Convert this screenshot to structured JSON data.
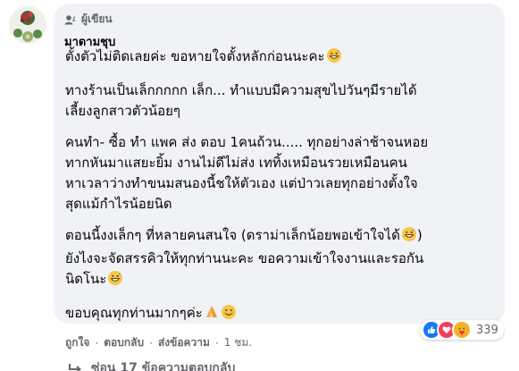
{
  "comment": {
    "author_badge": "ผู้เขียน",
    "author_name": "มาดามชุบ",
    "paragraphs": [
      {
        "lines": [
          "ตั้งตัวไม่ติดเลยค่ะ ขอหายใจตั้งหลักก่อนนะคะ"
        ]
      },
      {
        "lines": [
          "ทางร้านเป็นเล็กกกกก เล็ก... ทำแบบมีความสุขไปวันๆมีรายได้",
          "เลี้ยงลูกสาวตัวน้อยๆ"
        ]
      },
      {
        "lines": [
          "คนทำ- ซื้อ ทำ แพค ส่ง ตอบ 1คนถ้วน..... ทุกอย่างล่าช้าจนหอย",
          "ทากหันมาแสยะยิ้ม งานไม่ดีไม่ส่ง เททิ้งเหมือนรวยเหมือนคน",
          "หาเวลาว่างทำขนมสนองนี้ชให้ตัวเอง แต่ป่าวเลยทุกอย่างตั้งใจ",
          "สุดแม้กำไรน้อยนิด"
        ]
      },
      {
        "lines": [
          "ตอนนี้งงเล็กๆ ที่หลายคนสนใจ (ดราม่าเล็กน้อยพอเข้าใจได้",
          "ยังไงจะจัดสรรคิวให้ทุกท่านนะคะ ขอความเข้าใจงานและรอกัน",
          "นิดโนะ"
        ]
      },
      {
        "lines": [
          "ขอบคุณทุกท่านมากๆค่ะ"
        ]
      }
    ]
  },
  "reactions": {
    "icons": [
      "like-icon",
      "love-icon",
      "care-icon"
    ],
    "count": "339"
  },
  "actions": {
    "like": "ถูกใจ",
    "reply": "ตอบกลับ",
    "share": "ส่งข้อความ",
    "time": "1 ชม."
  },
  "replies": {
    "label": "ซ่อน 17 ข้อความตอบกลับ"
  },
  "colors": {
    "bubble_bg": "#f0f2f5",
    "secondary_text": "#65676b",
    "like_blue": "#1877f2",
    "love_red": "#f33e58",
    "care_yellow": "#f7b125"
  }
}
